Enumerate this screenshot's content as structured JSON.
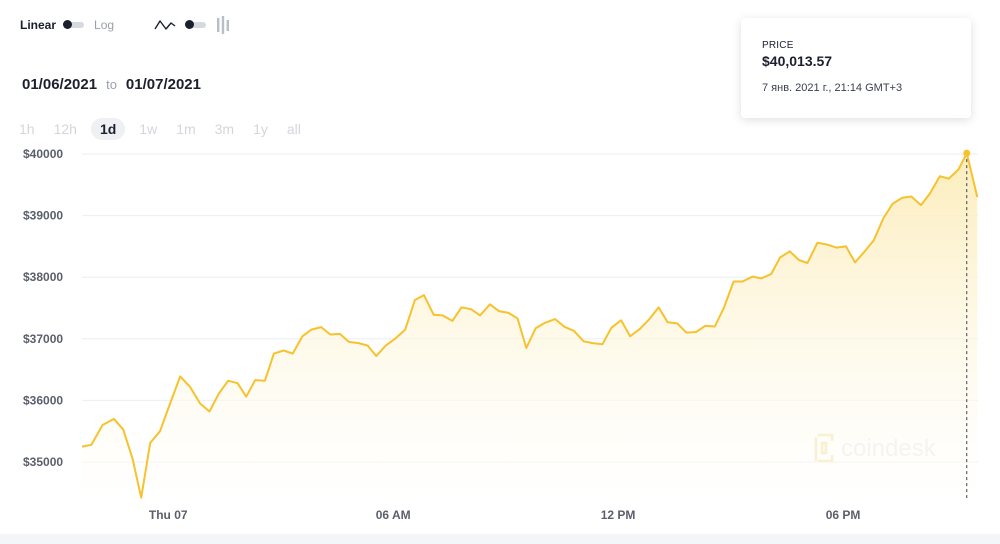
{
  "toolbar": {
    "linear_label": "Linear",
    "log_label": "Log",
    "line_icon": "line-chart-icon",
    "candle_icon": "candlestick-icon"
  },
  "date_range": {
    "from": "01/06/2021",
    "to_word": "to",
    "to": "01/07/2021"
  },
  "timeframes": [
    "1h",
    "12h",
    "1d",
    "1w",
    "1m",
    "3m",
    "1y",
    "all"
  ],
  "active_timeframe": "1d",
  "tooltip": {
    "label": "PRICE",
    "price": "$40,013.57",
    "time": "7 янв. 2021 г., 21:14 GMT+3"
  },
  "watermark": "coindesk",
  "colors": {
    "line": "#f6c22e",
    "fill": "#fdf1c9",
    "grid": "#eceef2",
    "axis_text": "#5a5f6b",
    "marker_line": "#3b3f4a"
  },
  "chart_data": {
    "type": "area",
    "title": "",
    "xlabel": "",
    "ylabel": "",
    "y_ticks": [
      "$40000",
      "$39000",
      "$38000",
      "$37000",
      "$36000",
      "$35000"
    ],
    "y_tick_values": [
      40000,
      39000,
      38000,
      37000,
      36000,
      35000
    ],
    "x_ticks": [
      {
        "label": "Thu 07",
        "hour": 0
      },
      {
        "label": "06 AM",
        "hour": 6
      },
      {
        "label": "12 PM",
        "hour": 12
      },
      {
        "label": "06 PM",
        "hour": 18
      }
    ],
    "ylim": [
      34300,
      40250
    ],
    "xlim": [
      -2.3,
      21.6
    ],
    "grid": true,
    "series": [
      {
        "points": [
          [
            -2.3,
            35250
          ],
          [
            -2.05,
            35280
          ],
          [
            -1.75,
            35600
          ],
          [
            -1.45,
            35700
          ],
          [
            -1.2,
            35530
          ],
          [
            -0.95,
            35050
          ],
          [
            -0.72,
            34420
          ],
          [
            -0.48,
            35310
          ],
          [
            -0.22,
            35500
          ],
          [
            0.05,
            35950
          ],
          [
            0.32,
            36390
          ],
          [
            0.58,
            36220
          ],
          [
            0.85,
            35950
          ],
          [
            1.1,
            35820
          ],
          [
            1.35,
            36110
          ],
          [
            1.6,
            36320
          ],
          [
            1.85,
            36280
          ],
          [
            2.08,
            36060
          ],
          [
            2.32,
            36330
          ],
          [
            2.58,
            36320
          ],
          [
            2.82,
            36760
          ],
          [
            3.08,
            36810
          ],
          [
            3.32,
            36760
          ],
          [
            3.58,
            37040
          ],
          [
            3.82,
            37150
          ],
          [
            4.08,
            37190
          ],
          [
            4.32,
            37070
          ],
          [
            4.58,
            37080
          ],
          [
            4.82,
            36950
          ],
          [
            5.08,
            36930
          ],
          [
            5.32,
            36890
          ],
          [
            5.55,
            36720
          ],
          [
            5.8,
            36890
          ],
          [
            6.05,
            37000
          ],
          [
            6.32,
            37150
          ],
          [
            6.58,
            37630
          ],
          [
            6.82,
            37710
          ],
          [
            7.08,
            37390
          ],
          [
            7.32,
            37380
          ],
          [
            7.58,
            37290
          ],
          [
            7.82,
            37510
          ],
          [
            8.08,
            37480
          ],
          [
            8.32,
            37380
          ],
          [
            8.58,
            37560
          ],
          [
            8.82,
            37450
          ],
          [
            9.08,
            37420
          ],
          [
            9.32,
            37330
          ],
          [
            9.55,
            36850
          ],
          [
            9.8,
            37170
          ],
          [
            10.05,
            37260
          ],
          [
            10.32,
            37320
          ],
          [
            10.58,
            37190
          ],
          [
            10.82,
            37130
          ],
          [
            11.08,
            36960
          ],
          [
            11.32,
            36930
          ],
          [
            11.58,
            36910
          ],
          [
            11.82,
            37180
          ],
          [
            12.08,
            37300
          ],
          [
            12.32,
            37040
          ],
          [
            12.58,
            37160
          ],
          [
            12.82,
            37310
          ],
          [
            13.08,
            37510
          ],
          [
            13.32,
            37270
          ],
          [
            13.58,
            37250
          ],
          [
            13.82,
            37100
          ],
          [
            14.08,
            37110
          ],
          [
            14.32,
            37210
          ],
          [
            14.58,
            37200
          ],
          [
            14.82,
            37500
          ],
          [
            15.08,
            37930
          ],
          [
            15.32,
            37930
          ],
          [
            15.58,
            38010
          ],
          [
            15.82,
            37980
          ],
          [
            16.08,
            38050
          ],
          [
            16.32,
            38320
          ],
          [
            16.58,
            38420
          ],
          [
            16.82,
            38280
          ],
          [
            17.05,
            38230
          ],
          [
            17.32,
            38560
          ],
          [
            17.58,
            38530
          ],
          [
            17.82,
            38480
          ],
          [
            18.08,
            38500
          ],
          [
            18.32,
            38240
          ],
          [
            18.58,
            38420
          ],
          [
            18.82,
            38600
          ],
          [
            19.08,
            38960
          ],
          [
            19.32,
            39190
          ],
          [
            19.58,
            39290
          ],
          [
            19.82,
            39310
          ],
          [
            20.08,
            39170
          ],
          [
            20.32,
            39360
          ],
          [
            20.58,
            39640
          ],
          [
            20.82,
            39600
          ],
          [
            21.08,
            39750
          ],
          [
            21.3,
            40013
          ],
          [
            21.58,
            39300
          ]
        ]
      }
    ],
    "highlight": {
      "x": 21.3,
      "y": 40013.57
    }
  }
}
